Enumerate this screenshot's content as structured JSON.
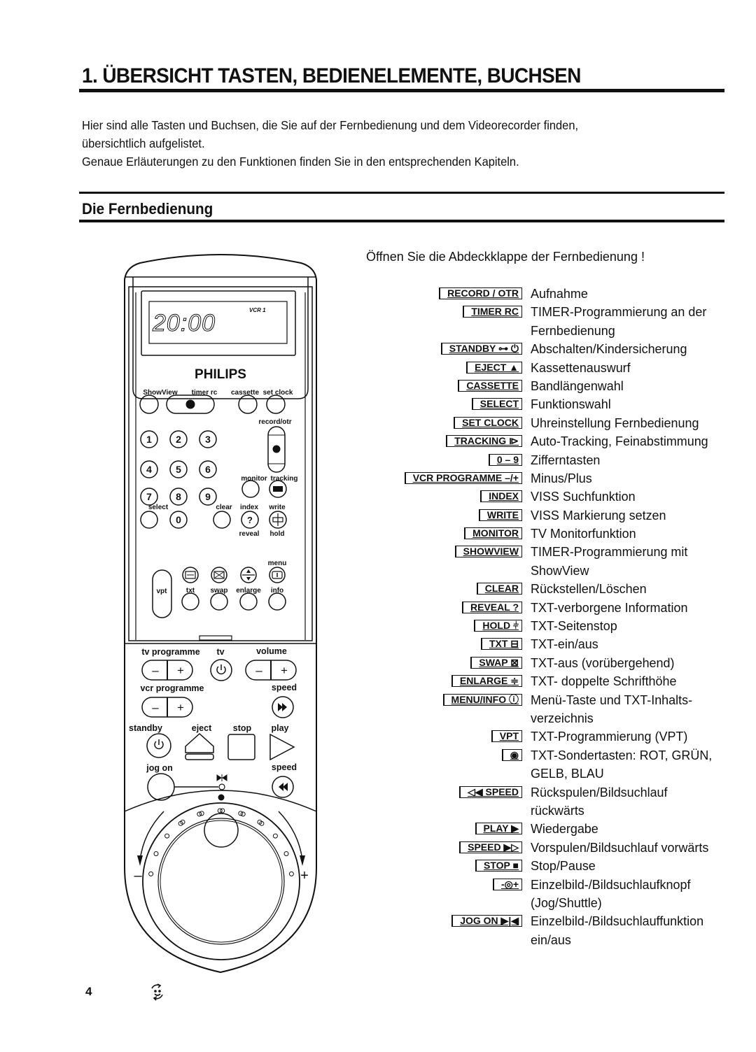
{
  "page": {
    "title": "1. ÜBERSICHT TASTEN, BEDIENELEMENTE, BUCHSEN",
    "intro_lines": [
      "Hier sind alle Tasten und Buchsen, die Sie  auf der Fernbedienung und dem Videorecorder finden,",
      "übersichtlich aufgelistet.",
      "Genaue Erläuterungen zu den Funktionen finden Sie in den entsprechenden Kapiteln."
    ],
    "section_title": "Die Fernbedienung",
    "open_note": "Öffnen Sie die Abdeckklappe der Fernbedienung !",
    "page_number": "4",
    "footer_icon": "recycle-smiley-icon"
  },
  "legend": [
    {
      "key": "RECORD / OTR",
      "desc": [
        "Aufnahme"
      ]
    },
    {
      "key": "TIMER RC",
      "desc": [
        "TIMER-Programmierung an der",
        "Fernbedienung"
      ]
    },
    {
      "key": "STANDBY ⊶ ⏻",
      "desc": [
        "Abschalten/Kindersicherung"
      ]
    },
    {
      "key": "EJECT ▲",
      "desc": [
        "Kassettenauswurf"
      ]
    },
    {
      "key": "CASSETTE",
      "desc": [
        "Bandlängenwahl"
      ]
    },
    {
      "key": "SELECT",
      "desc": [
        "Funktionswahl"
      ]
    },
    {
      "key": "SET CLOCK",
      "desc": [
        "Uhreinstellung Fernbedienung"
      ]
    },
    {
      "key": "TRACKING ⧐",
      "desc": [
        "Auto-Tracking, Feinabstimmung"
      ]
    },
    {
      "key": "0 – 9",
      "desc": [
        "Zifferntasten"
      ]
    },
    {
      "key": "VCR PROGRAMME –/+",
      "desc": [
        "Minus/Plus"
      ]
    },
    {
      "key": "INDEX",
      "desc": [
        "VISS Suchfunktion"
      ]
    },
    {
      "key": "WRITE",
      "desc": [
        "VISS Markierung setzen"
      ]
    },
    {
      "key": "MONITOR",
      "desc": [
        "TV Monitorfunktion"
      ]
    },
    {
      "key": "SHOWVIEW",
      "desc": [
        "TIMER-Programmierung mit",
        "ShowView"
      ]
    },
    {
      "key": "CLEAR",
      "desc": [
        "Rückstellen/Löschen"
      ]
    },
    {
      "key": "REVEAL ?",
      "desc": [
        "TXT-verborgene Information"
      ]
    },
    {
      "key": "HOLD ⫩",
      "desc": [
        "TXT-Seitenstop"
      ]
    },
    {
      "key": "TXT ⊟",
      "desc": [
        "TXT-ein/aus"
      ]
    },
    {
      "key": "SWAP ⊠",
      "desc": [
        "TXT-aus (vorübergehend)"
      ]
    },
    {
      "key": "ENLARGE ≑",
      "desc": [
        "TXT- doppelte Schrifthöhe"
      ]
    },
    {
      "key": "MENU/INFO ⓘ",
      "desc": [
        "Menü-Taste und TXT-Inhalts-",
        "verzeichnis"
      ]
    },
    {
      "key": "VPT",
      "desc": [
        "TXT-Programmierung (VPT)"
      ]
    },
    {
      "key": "◉",
      "desc": [
        "TXT-Sondertasten: ROT, GRÜN,",
        "GELB, BLAU"
      ]
    },
    {
      "key": "◁◀ SPEED",
      "desc": [
        "Rückspulen/Bildsuchlauf",
        "rückwärts"
      ]
    },
    {
      "key": "PLAY ▶",
      "desc": [
        "Wiedergabe"
      ]
    },
    {
      "key": "SPEED ▶▷",
      "desc": [
        "Vorspulen/Bildsuchlauf vorwärts"
      ]
    },
    {
      "key": "STOP ■",
      "desc": [
        "Stop/Pause"
      ]
    },
    {
      "key": "-◎+",
      "desc": [
        "Einzelbild-/Bildsuchlaufknopf",
        "(Jog/Shuttle)"
      ]
    },
    {
      "key": "JOG ON ▶|◀",
      "desc": [
        "Einzelbild-/Bildsuchlauffunktion",
        "ein/aus"
      ]
    }
  ],
  "remote": {
    "display_time": "20:00",
    "display_mode": "VCR 1",
    "brand": "PHILIPS",
    "labels": {
      "showview": "ShowView",
      "timer_rc": "timer rc",
      "cassette": "cassette",
      "set_clock": "set clock",
      "record_otr": "record/otr",
      "monitor": "monitor",
      "tracking": "tracking",
      "select": "select",
      "clear": "clear",
      "index": "index",
      "write": "write",
      "reveal": "reveal",
      "hold": "hold",
      "menu": "menu",
      "vpt": "vpt",
      "txt": "txt",
      "swap": "swap",
      "enlarge": "enlarge",
      "info": "info",
      "tv_programme": "tv programme",
      "tv": "tv",
      "volume": "volume",
      "vcr_programme": "vcr programme",
      "speed_fwd": "speed",
      "standby": "standby",
      "eject": "eject",
      "stop": "stop",
      "play": "play",
      "jog_on": "jog on",
      "speed_rev": "speed"
    },
    "digits": [
      "1",
      "2",
      "3",
      "4",
      "5",
      "6",
      "7",
      "8",
      "9",
      "0"
    ],
    "minus": "–",
    "plus": "+",
    "question": "?"
  }
}
